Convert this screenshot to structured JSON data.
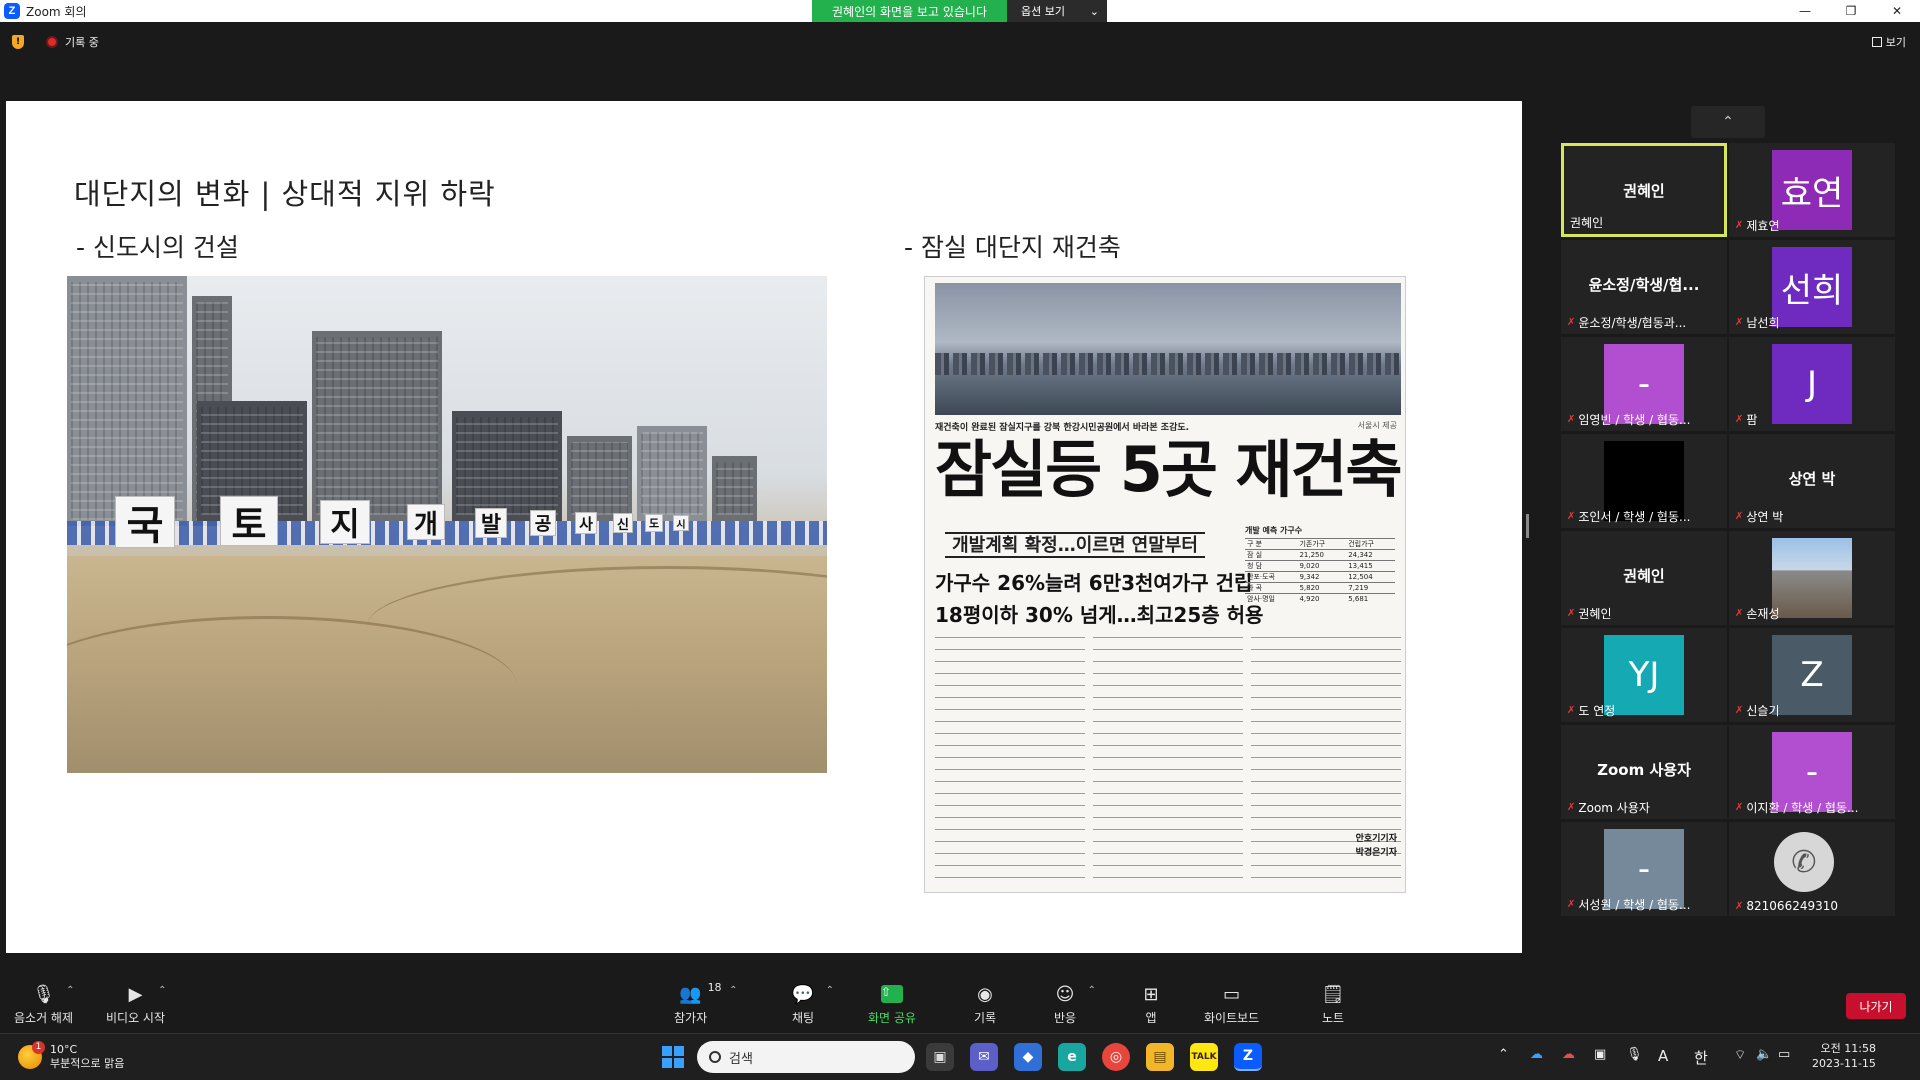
{
  "window": {
    "title": "Zoom 회의",
    "logo_letter": "Z",
    "minimize": "—",
    "maximize": "❐",
    "close": "✕"
  },
  "share_banner": {
    "text": "권혜인의 화면을 보고 있습니다",
    "options_label": "옵션 보기",
    "options_caret": "⌄"
  },
  "topbar": {
    "shield_glyph": "!",
    "recording_label": "기록 중",
    "view_label": "보기"
  },
  "slide": {
    "title": "대단지의 변화 | 상대적 지위 하락",
    "left_subtitle": "- 신도시의 건설",
    "right_subtitle": "- 잠실 대단지 재건축",
    "photo_signs": [
      "국",
      "토",
      "지",
      "개",
      "발",
      "공",
      "사",
      "신",
      "도",
      "시"
    ],
    "newspaper": {
      "caption": "재건축이 완료된 잠실지구를 강북 한강시민공원에서 바라본 조감도.",
      "credit": "서울시 제공",
      "headline": "잠실등 5곳 재건축",
      "subhead": "개발계획 확정…이르면 연말부터",
      "line1": "가구수 26%늘려 6만3천여가구 건립",
      "line2": "18평이하 30% 넘게…최고25층 허용",
      "table_title": "개발 예측 가구수",
      "table_header": [
        "구 분",
        "기존가구",
        "건립가구"
      ],
      "table_rows": [
        [
          "잠 실",
          "21,250",
          "24,342"
        ],
        [
          "청 담",
          "9,020",
          "13,415"
        ],
        [
          "반포·도곡",
          "9,342",
          "12,504"
        ],
        [
          "화 곡",
          "5,820",
          "7,219"
        ],
        [
          "암사·명일",
          "4,920",
          "5,681"
        ]
      ],
      "byline1": "안호기기자",
      "byline2": "박경은기자"
    }
  },
  "gallery": {
    "scroll_up": "⌃",
    "tiles": [
      {
        "display": "권혜인",
        "label": "권혜인",
        "muted": false,
        "active": true
      },
      {
        "avatar": "효연",
        "label": "제효연",
        "muted": true
      },
      {
        "display": "윤소정/학생/협...",
        "label": "윤소정/학생/협동과...",
        "muted": true
      },
      {
        "avatar": "선희",
        "label": "남선희",
        "muted": true
      },
      {
        "avatar": "-",
        "label": "임영빈 / 학생 / 협동...",
        "muted": true
      },
      {
        "avatar": "J",
        "label": "팜",
        "muted": true
      },
      {
        "label": "조인서 / 학생 / 협동...",
        "muted": true
      },
      {
        "display": "상연 박",
        "label": "상연 박",
        "muted": true
      },
      {
        "display": "권혜인",
        "label": "권혜인",
        "muted": true
      },
      {
        "label": "손재성",
        "muted": true
      },
      {
        "avatar": "YJ",
        "label": "도 연정",
        "muted": true
      },
      {
        "avatar": "Z",
        "label": "신슬기",
        "muted": true
      },
      {
        "display": "Zoom 사용자",
        "label": "Zoom 사용자",
        "muted": true
      },
      {
        "avatar": "-",
        "label": "이지환 / 학생 / 협동...",
        "muted": true
      },
      {
        "avatar": "-",
        "label": "서성원 / 학생 / 협동...",
        "muted": true
      },
      {
        "label": "821066249310",
        "muted": true
      }
    ]
  },
  "toolbar": {
    "unmute": "음소거 해제",
    "start_video": "비디오 시작",
    "participants": "참가자",
    "participants_count": "18",
    "chat": "채팅",
    "share_screen": "화면 공유",
    "record": "기록",
    "reactions": "반응",
    "apps": "앱",
    "whiteboard": "화이트보드",
    "notes": "노트",
    "leave": "나가기"
  },
  "taskbar": {
    "weather_temp": "10°C",
    "weather_desc": "부분적으로 맑음",
    "weather_badge": "1",
    "search_placeholder": "검색",
    "time": "오전 11:58",
    "date": "2023-11-15",
    "ime": "한",
    "ime_alt": "A",
    "tray_caret": "⌃"
  }
}
